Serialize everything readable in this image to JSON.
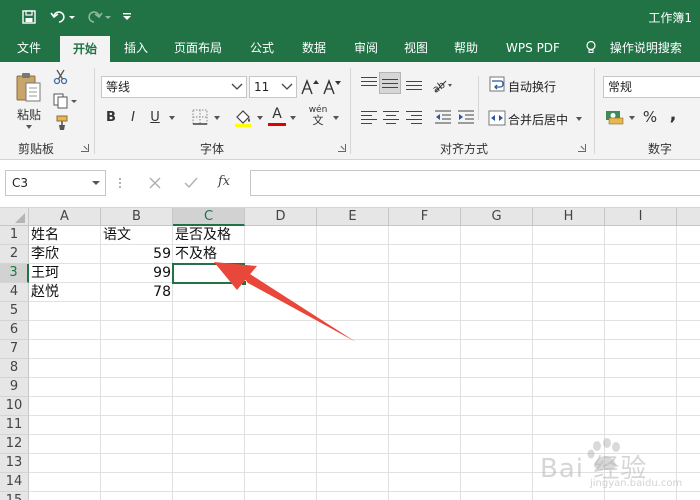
{
  "window": {
    "title": "工作簿1"
  },
  "tabs": [
    {
      "label": "文件",
      "active": false
    },
    {
      "label": "开始",
      "active": true
    },
    {
      "label": "插入",
      "active": false
    },
    {
      "label": "页面布局",
      "active": false
    },
    {
      "label": "公式",
      "active": false
    },
    {
      "label": "数据",
      "active": false
    },
    {
      "label": "审阅",
      "active": false
    },
    {
      "label": "视图",
      "active": false
    },
    {
      "label": "帮助",
      "active": false
    },
    {
      "label": "WPS PDF",
      "active": false
    }
  ],
  "tell_me": {
    "label": "操作说明搜索"
  },
  "ribbon": {
    "clipboard": {
      "paste_label": "粘贴",
      "group_label": "剪贴板"
    },
    "font": {
      "font_name": "等线",
      "font_size": "11",
      "bold": "B",
      "italic": "I",
      "underline": "U",
      "font_color_glyph": "A",
      "phonetic_glyph": "wén",
      "group_label": "字体"
    },
    "alignment": {
      "wrap_text": "自动换行",
      "merge_center": "合并后居中",
      "group_label": "对齐方式"
    },
    "number": {
      "format": "常规",
      "percent": "%",
      "comma": ",",
      "group_label": "数字"
    }
  },
  "formula_bar": {
    "name_box": "C3",
    "fx": "fx",
    "value": ""
  },
  "sheet": {
    "columns": [
      "A",
      "B",
      "C",
      "D",
      "E",
      "F",
      "G",
      "H",
      "I"
    ],
    "selected_column": "C",
    "rows": [
      "1",
      "2",
      "3",
      "4",
      "5",
      "6",
      "7",
      "8",
      "9",
      "10",
      "11",
      "12",
      "13",
      "14",
      "15"
    ],
    "selected_row": "3",
    "cells": {
      "A1": "姓名",
      "B1": "语文",
      "C1": "是否及格",
      "A2": "李欣",
      "B2": "59",
      "C2": "不及格",
      "A3": "王珂",
      "B3": "99",
      "A4": "赵悦",
      "B4": "78"
    },
    "selected_cell": "C3"
  },
  "annotation": {
    "color": "#e8473a"
  },
  "watermark": {
    "text": "Bai 经验",
    "url": "jingyan.baidu.com"
  },
  "colors": {
    "accent": "#217346",
    "selection": "#217346"
  }
}
